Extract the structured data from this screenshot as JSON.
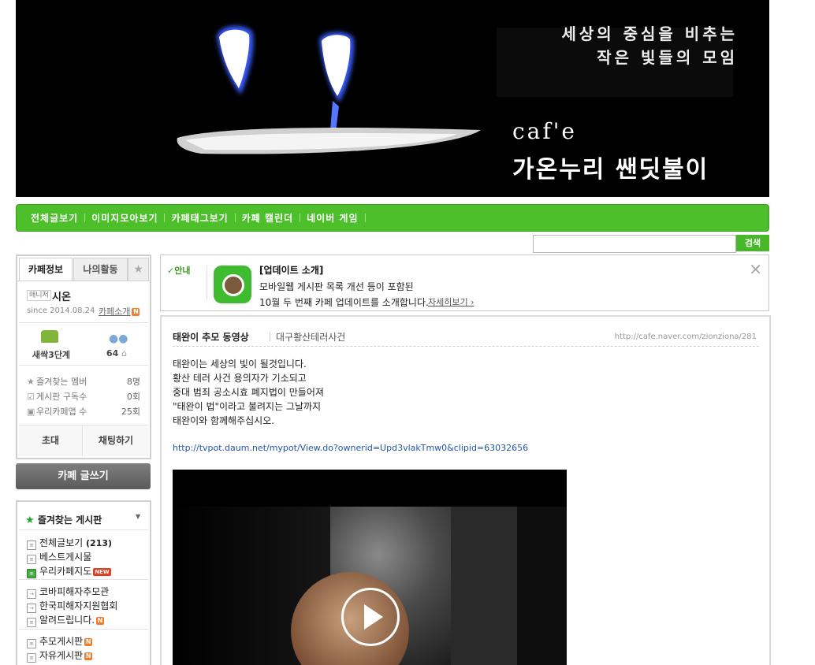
{
  "banner": {
    "tagline_line1": "세상의 중심을 비추는",
    "tagline_line2": "작은 빛들의 모임",
    "cafe_word": "caf'e",
    "cafe_name": "가온누리 쌘딧불이"
  },
  "menu": {
    "items": [
      "전체글보기",
      "이미지모아보기",
      "카페태그보기",
      "카페 캘린더",
      "네이버 게임"
    ]
  },
  "search": {
    "value": "",
    "button_label": "검색"
  },
  "sidebar": {
    "tabs": {
      "info": "카페정보",
      "activity": "나의활동",
      "star": "★"
    },
    "manager_badge": "매니저",
    "manager_name": "시온",
    "since": "since 2014.08.24",
    "cafe_intro": "카페소개",
    "new_badge": "N",
    "level_label": "새싹3단계",
    "member_count": "64",
    "stats": [
      {
        "label": "즐겨찾는 멤버",
        "value": "8명"
      },
      {
        "label": "게시판 구독수",
        "value": "0회"
      },
      {
        "label": "우리카페앱 수",
        "value": "25회"
      }
    ],
    "invite_label": "초대",
    "chat_label": "채팅하기",
    "write_label": "카페 글쓰기",
    "favorites": {
      "title": "즐겨찾는 게시판",
      "items": [
        {
          "label": "전체글보기",
          "count": "(213)"
        },
        {
          "label": "베스트게시물"
        },
        {
          "label": "우리카페지도",
          "badge": "NEW"
        },
        {
          "label": "코바피해자추모관"
        },
        {
          "label": "한국피해자지원협회"
        },
        {
          "label": "알려드립니다.",
          "badge": "N"
        },
        {
          "label": "추모게시판",
          "badge": "N"
        },
        {
          "label": "자유게시판",
          "badge": "N"
        }
      ]
    }
  },
  "notice": {
    "label": "✓안내",
    "title": "[업데이트 소개]",
    "line1": "모바일웹 게시판 목록 개선 등이 포함된",
    "line2": "10월 두 번째 카페 업데이트를 소개합니다.",
    "more": "자세히보기 ›",
    "close": "✕"
  },
  "article": {
    "title": "태완이 추모 동영상",
    "board": "대구황산테러사건",
    "url": "http://cafe.naver.com/zionziona/281",
    "lines": [
      "태완이는 세상의 빛이 될것입니다.",
      "황산 테러 사건 용의자가 기소되고",
      "중대 범죄 공소시효 폐지법이 만들어져",
      "\"태완이 법\"이라고 불려지는 그날까지",
      "태완이와 함께해주십시오."
    ],
    "link": "http://tvpot.daum.net/mypot/View.do?ownerid=Upd3vlakTmw0&clipid=63032656"
  }
}
